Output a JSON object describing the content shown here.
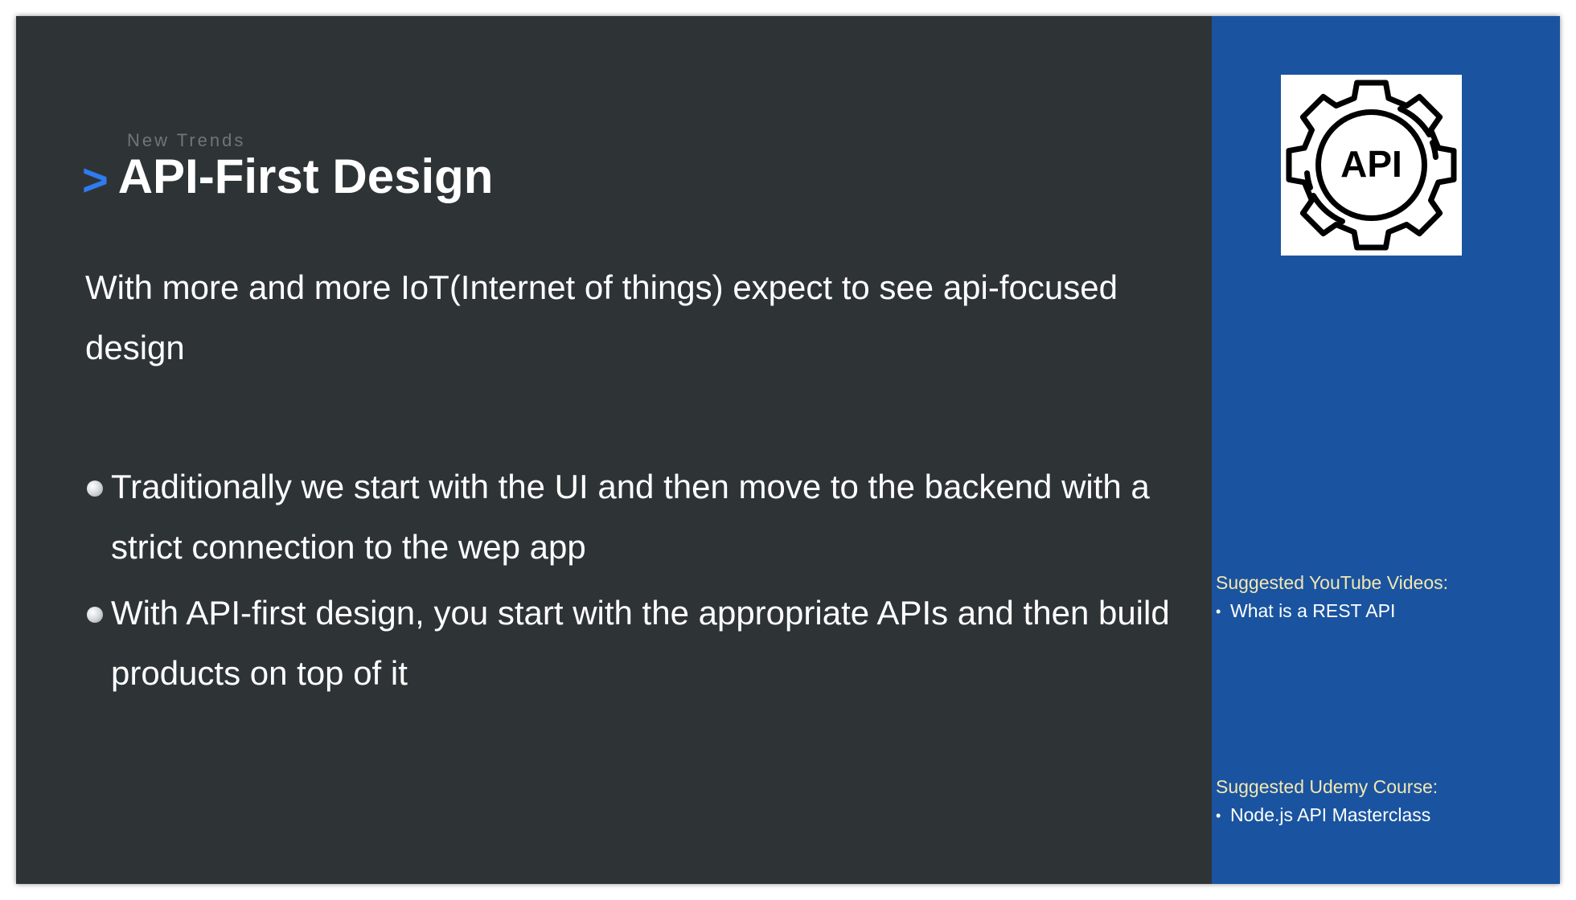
{
  "slide": {
    "kicker": "New Trends",
    "title_marker": ">",
    "title": "API-First Design",
    "intro": "With more and more IoT(Internet of things) expect to see api-focused design",
    "bullets": [
      "Traditionally we start with the UI and then move to the backend with a strict connection to the wep app",
      "With API-first design, you start with the appropriate APIs and then build products on top of it"
    ]
  },
  "sidebar": {
    "logo_text": "API",
    "youtube": {
      "heading": "Suggested YouTube Videos:",
      "items": [
        "What is a REST API"
      ]
    },
    "udemy": {
      "heading": "Suggested Udemy Course:",
      "items": [
        "Node.js API Masterclass"
      ]
    }
  },
  "colors": {
    "main_bg": "#2e3436",
    "sidebar_bg": "#1a54a0",
    "accent": "#2f7bf0",
    "sidebar_heading": "#f3e7b1"
  }
}
